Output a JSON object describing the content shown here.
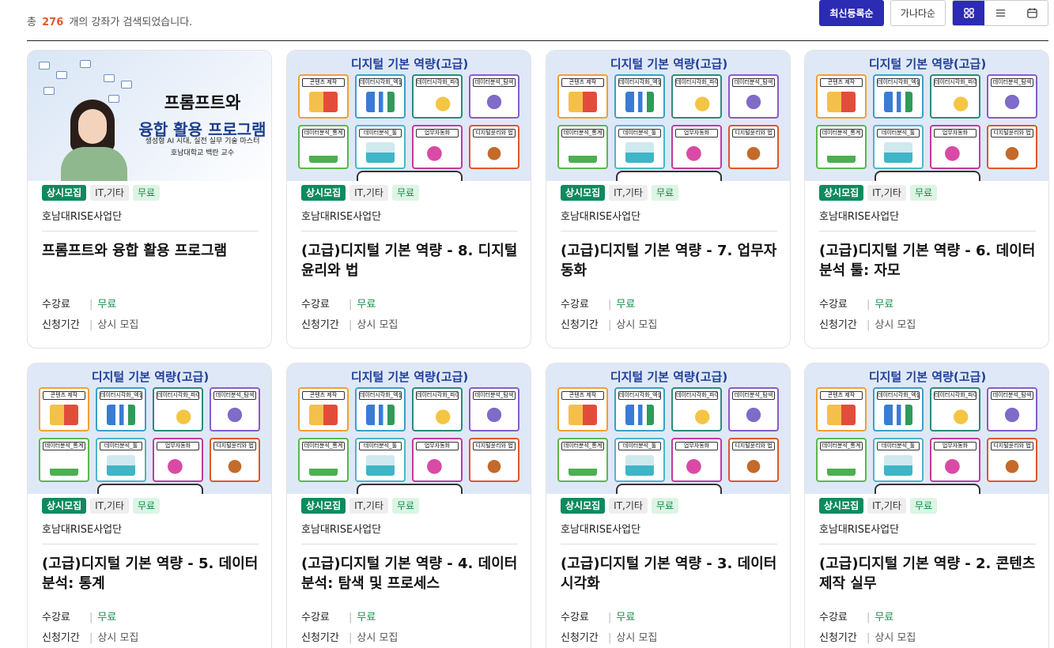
{
  "summary": {
    "prefix": "총",
    "count": "276",
    "suffix": "개의 강좌가 검색되었습니다."
  },
  "sort": {
    "latest": "최신등록순",
    "alpha": "가나다순"
  },
  "views": [
    "grid-icon",
    "list-icon",
    "calendar-icon"
  ],
  "thumbs": {
    "digital_title": "디지털 기본 역량(고급)",
    "tiles": [
      "콘텐츠 제작",
      "데이터시각화_엑셀",
      "데이터시각화_파이썬",
      "데이터분석_탐색",
      "데이터분석_통계",
      "데이터분석_툴",
      "업무자동화",
      "디지털윤리와 법"
    ],
    "prompt_l1": "프롬프트와",
    "prompt_l2": "융합 활용 프로그램",
    "prompt_sub1": "생성형 AI 시대, 실전 실무 기술 마스터",
    "prompt_sub2": "호남대학교 백란 교수"
  },
  "labels": {
    "fee": "수강료",
    "period": "신청기간"
  },
  "courses": [
    {
      "status": "상시모집",
      "category": "IT,기타",
      "free_tag": "무료",
      "org": "호남대RISE사업단",
      "title": "프롬프트와 융합 활용 프로그램",
      "fee": "무료",
      "period": "상시 모집"
    },
    {
      "status": "상시모집",
      "category": "IT,기타",
      "free_tag": "무료",
      "org": "호남대RISE사업단",
      "title": "(고급)디지털 기본 역량 - 8. 디지털 윤리와 법",
      "fee": "무료",
      "period": "상시 모집"
    },
    {
      "status": "상시모집",
      "category": "IT,기타",
      "free_tag": "무료",
      "org": "호남대RISE사업단",
      "title": "(고급)디지털 기본 역량 - 7. 업무자동화",
      "fee": "무료",
      "period": "상시 모집"
    },
    {
      "status": "상시모집",
      "category": "IT,기타",
      "free_tag": "무료",
      "org": "호남대RISE사업단",
      "title": "(고급)디지털 기본 역량 - 6. 데이터 분석 툴: 자모",
      "fee": "무료",
      "period": "상시 모집"
    },
    {
      "status": "상시모집",
      "category": "IT,기타",
      "free_tag": "무료",
      "org": "호남대RISE사업단",
      "title": "(고급)디지털 기본 역량 - 5. 데이터 분석: 통계",
      "fee": "무료",
      "period": "상시 모집"
    },
    {
      "status": "상시모집",
      "category": "IT,기타",
      "free_tag": "무료",
      "org": "호남대RISE사업단",
      "title": "(고급)디지털 기본 역량 - 4. 데이터 분석: 탐색 및 프로세스",
      "fee": "무료",
      "period": "상시 모집"
    },
    {
      "status": "상시모집",
      "category": "IT,기타",
      "free_tag": "무료",
      "org": "호남대RISE사업단",
      "title": "(고급)디지털 기본 역량 - 3. 데이터시각화",
      "fee": "무료",
      "period": "상시 모집"
    },
    {
      "status": "상시모집",
      "category": "IT,기타",
      "free_tag": "무료",
      "org": "호남대RISE사업단",
      "title": "(고급)디지털 기본 역량 - 2. 콘텐츠 제작 실무",
      "fee": "무료",
      "period": "상시 모집"
    }
  ]
}
